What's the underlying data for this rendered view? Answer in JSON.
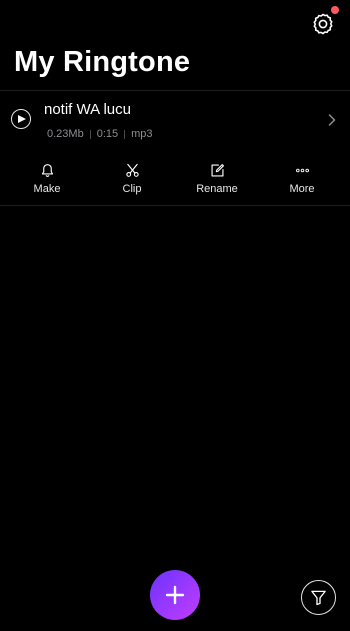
{
  "colors": {
    "background": "#000000",
    "notification_dot": "#ff5a5f",
    "fab_gradient_start": "#6a34ff",
    "fab_gradient_end": "#c43cff",
    "meta_text": "#8e8e93"
  },
  "header": {
    "title": "My Ringtone",
    "settings_icon": "gear-icon",
    "has_notification": true
  },
  "ringtones": [
    {
      "title": "notif WA lucu",
      "size": "0.23Mb",
      "duration": "0:15",
      "format": "mp3"
    }
  ],
  "actions": {
    "make": {
      "label": "Make",
      "icon": "bell-icon"
    },
    "clip": {
      "label": "Clip",
      "icon": "scissors-icon"
    },
    "rename": {
      "label": "Rename",
      "icon": "edit-icon"
    },
    "more": {
      "label": "More",
      "icon": "more-dots-icon"
    }
  },
  "bottom": {
    "add_icon": "plus-icon",
    "filter_icon": "filter-icon"
  }
}
